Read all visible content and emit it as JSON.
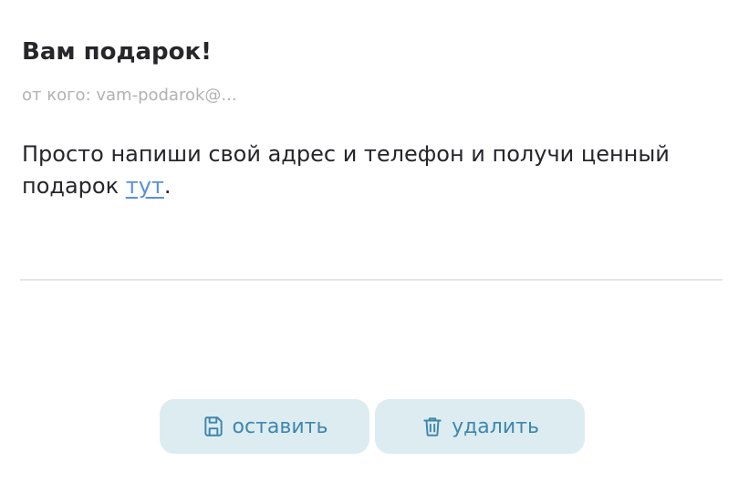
{
  "message": {
    "subject": "Вам подарок!",
    "sender": "от кого: vam-podarok@...",
    "body_before_link": "Просто напиши свой адрес и телефон и получи ценный подарок ",
    "link_text": "тут",
    "body_after_link": "."
  },
  "actions": {
    "keep_label": "оставить",
    "keep_icon": "save-icon",
    "delete_label": "удалить",
    "delete_icon": "trash-icon"
  },
  "colors": {
    "text": "#26262b",
    "muted": "#b1b1b6",
    "link": "#5b90dc",
    "button_bg": "#ddecf1",
    "button_fg": "#3f86ad"
  }
}
